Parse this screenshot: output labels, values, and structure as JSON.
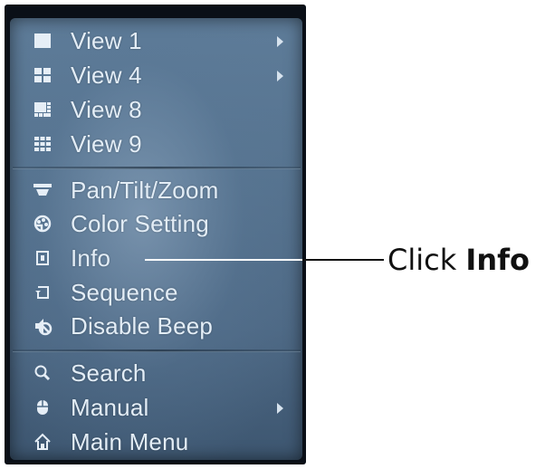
{
  "menu": {
    "groups": [
      {
        "items": [
          {
            "label": "View 1",
            "icon": "single-screen-icon",
            "has_submenu": true
          },
          {
            "label": "View 4",
            "icon": "quad-grid-icon",
            "has_submenu": true
          },
          {
            "label": "View 8",
            "icon": "eight-grid-icon",
            "has_submenu": false
          },
          {
            "label": "View 9",
            "icon": "nine-grid-icon",
            "has_submenu": false
          }
        ]
      },
      {
        "items": [
          {
            "label": "Pan/Tilt/Zoom",
            "icon": "ptz-camera-icon",
            "has_submenu": false
          },
          {
            "label": "Color Setting",
            "icon": "palette-icon",
            "has_submenu": false
          },
          {
            "label": "Info",
            "icon": "info-square-icon",
            "has_submenu": false
          },
          {
            "label": "Sequence",
            "icon": "sequence-loop-icon",
            "has_submenu": false
          },
          {
            "label": "Disable Beep",
            "icon": "speaker-mute-icon",
            "has_submenu": false
          }
        ]
      },
      {
        "items": [
          {
            "label": "Search",
            "icon": "search-icon",
            "has_submenu": false
          },
          {
            "label": "Manual",
            "icon": "mouse-icon",
            "has_submenu": true
          },
          {
            "label": "Main Menu",
            "icon": "home-icon",
            "has_submenu": false
          }
        ]
      }
    ]
  },
  "callout": {
    "prefix": "Click ",
    "target": "Info"
  },
  "colors": {
    "panel": "#56738f",
    "text": "#e3edf6",
    "callout_text": "#111111"
  }
}
